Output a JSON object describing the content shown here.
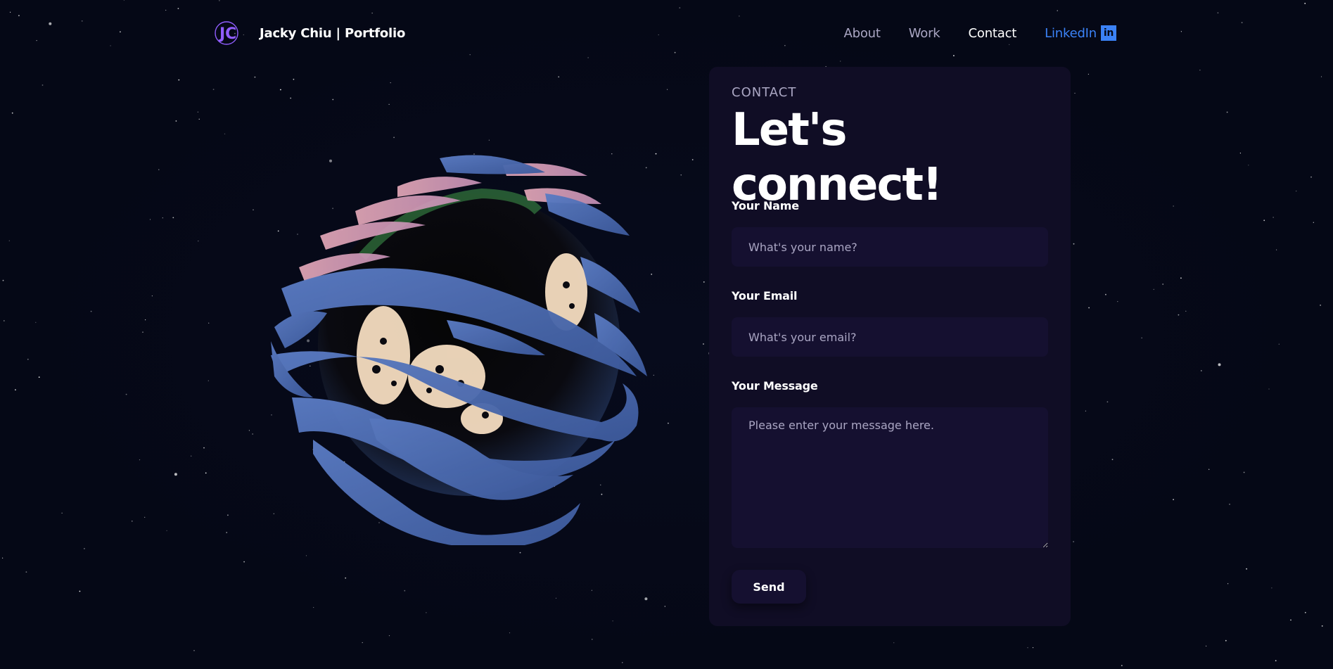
{
  "nav": {
    "brand_name": "Jacky Chiu | Portfolio",
    "logo_text": "JC",
    "links": [
      {
        "label": "About"
      },
      {
        "label": "Work"
      },
      {
        "label": "Contact"
      },
      {
        "label": "LinkedIn"
      }
    ],
    "active_link": "Contact",
    "linkedin_icon_text": "in"
  },
  "contact": {
    "eyebrow": "CONTACT",
    "headline": "Let's connect!",
    "name_label": "Your Name",
    "name_placeholder": "What's your name?",
    "email_label": "Your Email",
    "email_placeholder": "What's your email?",
    "message_label": "Your Message",
    "message_placeholder": "Please enter your message here.",
    "send_label": "Send"
  },
  "colors": {
    "background": "#050816",
    "card": "#100d25",
    "input": "#151030",
    "secondary_text": "#aaa6c3",
    "linkedin_accent": "#3b82f6",
    "logo_accent": "#915eff"
  },
  "icons": {
    "logo": "jc-logo-icon",
    "linkedin": "linkedin-icon",
    "globe": "earth-globe-icon"
  }
}
